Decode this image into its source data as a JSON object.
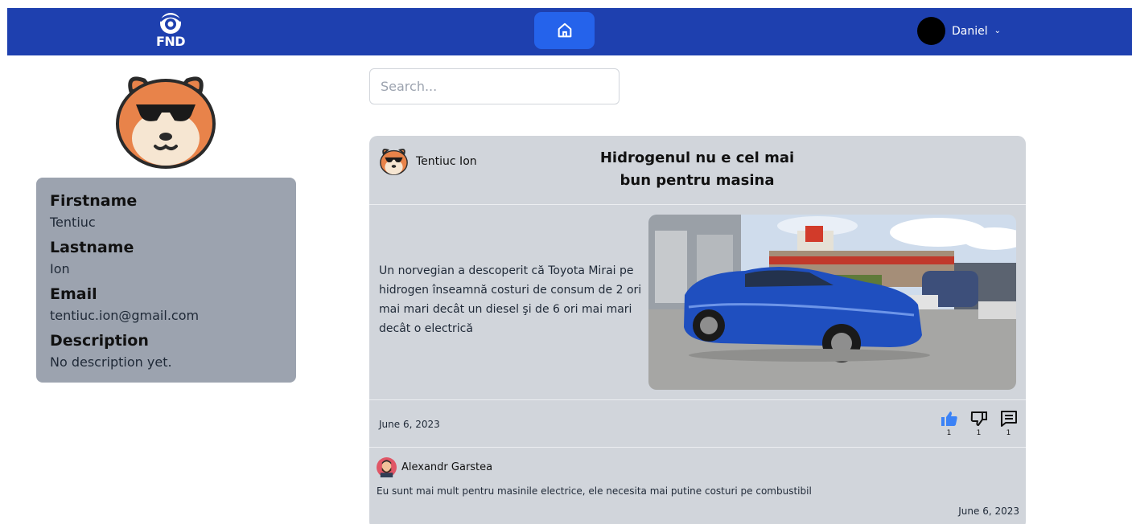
{
  "navbar": {
    "logo_text": "FND",
    "user_name": "Daniel",
    "accent_color": "#1e40af"
  },
  "profile": {
    "fields": [
      {
        "label": "Firstname",
        "value": "Tentiuc"
      },
      {
        "label": "Lastname",
        "value": "Ion"
      },
      {
        "label": "Email",
        "value": "tentiuc.ion@gmail.com"
      },
      {
        "label": "Description",
        "value": "No description yet."
      }
    ]
  },
  "search": {
    "placeholder": "Search...",
    "value": ""
  },
  "post": {
    "author": "Tentiuc Ion",
    "title": "Hidrogenul nu e cel mai bun pentru masina",
    "body": "Un norvegian a descoperit că Toyota Mirai pe hidrogen înseamnă costuri de consum de 2 ori mai mari decât un diesel şi de 6 ori mai mari decât o electrică",
    "date": "June 6, 2023",
    "likes": "1",
    "dislikes": "1",
    "comments_count": "1",
    "image_icon": "blue-car-photo"
  },
  "comment": {
    "author": "Alexandr Garstea",
    "text": "Eu sunt mai mult pentru masinile electrice, ele necesita mai putine costuri pe combustibil",
    "date": "June 6, 2023"
  }
}
